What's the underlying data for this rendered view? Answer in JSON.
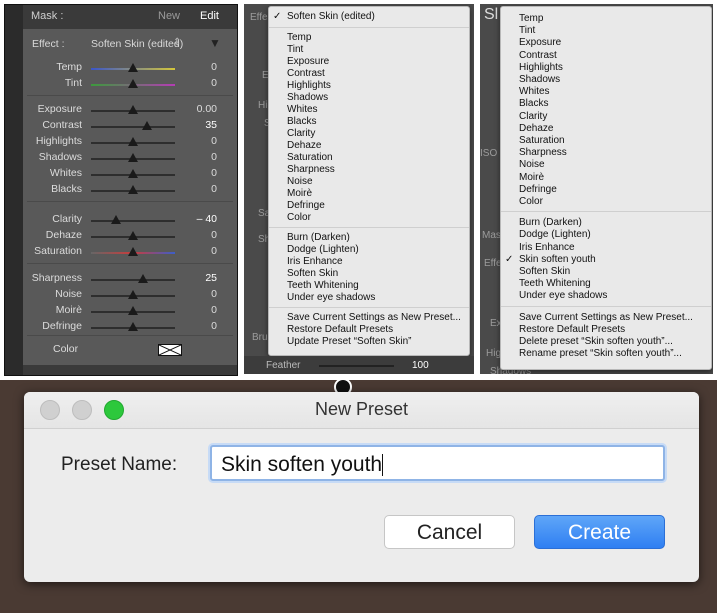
{
  "panel1": {
    "mask_label": "Mask :",
    "new_label": "New",
    "edit_label": "Edit",
    "effect_key": "Effect :",
    "effect_value": "Soften Skin (edited)",
    "effect_chevron": "⇕",
    "effect_menu_icon": "▼",
    "groups": [
      [
        {
          "name": "Temp",
          "value": "0",
          "pos": 0.5
        },
        {
          "name": "Tint",
          "value": "0",
          "pos": 0.5
        }
      ],
      [
        {
          "name": "Exposure",
          "value": "0.00",
          "pos": 0.5
        },
        {
          "name": "Contrast",
          "value": "35",
          "pos": 0.67
        },
        {
          "name": "Highlights",
          "value": "0",
          "pos": 0.5
        },
        {
          "name": "Shadows",
          "value": "0",
          "pos": 0.5
        },
        {
          "name": "Whites",
          "value": "0",
          "pos": 0.5
        },
        {
          "name": "Blacks",
          "value": "0",
          "pos": 0.5
        }
      ],
      [
        {
          "name": "Clarity",
          "value": "– 40",
          "pos": 0.3
        },
        {
          "name": "Dehaze",
          "value": "0",
          "pos": 0.5
        },
        {
          "name": "Saturation",
          "value": "0",
          "pos": 0.5
        }
      ],
      [
        {
          "name": "Sharpness",
          "value": "25",
          "pos": 0.62
        },
        {
          "name": "Noise",
          "value": "0",
          "pos": 0.5
        },
        {
          "name": "Moirè",
          "value": "0",
          "pos": 0.5
        },
        {
          "name": "Defringe",
          "value": "0",
          "pos": 0.5
        }
      ]
    ],
    "color_label": "Color"
  },
  "panel2": {
    "ghost": [
      "Effe",
      "Ex",
      "Hig",
      "Sh",
      "Sat",
      "Sh",
      "Bru"
    ],
    "menu_top": [
      {
        "label": "Soften Skin (edited)",
        "checked": true
      }
    ],
    "menu_effects": [
      "Temp",
      "Tint",
      "Exposure",
      "Contrast",
      "Highlights",
      "Shadows",
      "Whites",
      "Blacks",
      "Clarity",
      "Dehaze",
      "Saturation",
      "Sharpness",
      "Noise",
      "Moirè",
      "Defringe",
      "Color"
    ],
    "menu_presets": [
      "Burn (Darken)",
      "Dodge (Lighten)",
      "Iris Enhance",
      "Soften Skin",
      "Teeth Whitening",
      "Under eye shadows"
    ],
    "menu_actions": [
      "Save Current Settings as New Preset...",
      "Restore Default Presets",
      "Update Preset “Soften Skin”"
    ],
    "feather_label": "Feather",
    "feather_value": "100"
  },
  "panel3": {
    "ghost": [
      "Sl",
      "ISO 1",
      "Mas",
      "Effe",
      "Ex",
      "Hig",
      "Shadows"
    ],
    "menu_effects": [
      "Temp",
      "Tint",
      "Exposure",
      "Contrast",
      "Highlights",
      "Shadows",
      "Whites",
      "Blacks",
      "Clarity",
      "Dehaze",
      "Saturation",
      "Sharpness",
      "Noise",
      "Moirè",
      "Defringe",
      "Color"
    ],
    "menu_presets": [
      {
        "label": "Burn (Darken)",
        "checked": false
      },
      {
        "label": "Dodge (Lighten)",
        "checked": false
      },
      {
        "label": "Iris Enhance",
        "checked": false
      },
      {
        "label": "Skin soften youth",
        "checked": true
      },
      {
        "label": "Soften Skin",
        "checked": false
      },
      {
        "label": "Teeth Whitening",
        "checked": false
      },
      {
        "label": "Under eye shadows",
        "checked": false
      }
    ],
    "menu_actions": [
      "Save Current Settings as New Preset...",
      "Restore Default Presets",
      "Delete preset “Skin soften youth”...",
      "Rename preset “Skin soften youth”..."
    ]
  },
  "dialog": {
    "title": "New Preset",
    "preset_label": "Preset Name:",
    "preset_value": "Skin soften youth",
    "cancel_label": "Cancel",
    "create_label": "Create",
    "colors": {
      "close": "#d0d0d0",
      "minimize": "#d0d0d0",
      "zoom": "#2dc83c",
      "accent": "#3a86f3"
    }
  }
}
